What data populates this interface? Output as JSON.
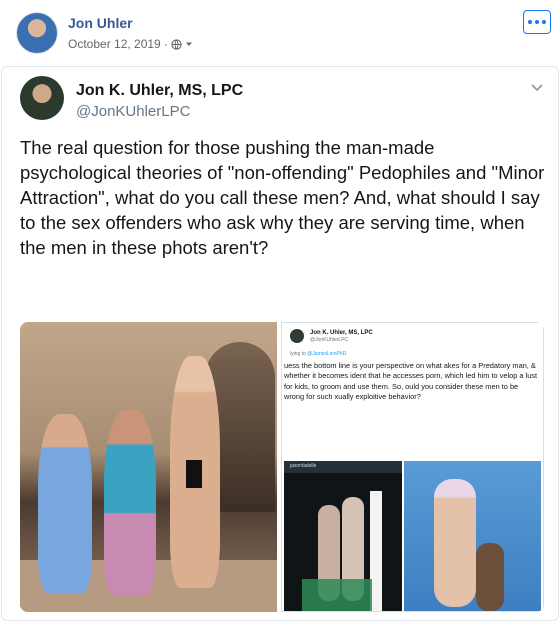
{
  "post": {
    "author": "Jon Uhler",
    "date": "October 12, 2019",
    "separator": "·",
    "privacy_icon": "globe-icon",
    "more_icon": "more-options-icon"
  },
  "tweet": {
    "name": "Jon K. Uhler, MS, LPC",
    "handle": "@JonKUhlerLPC",
    "text": "The real question for those pushing the man-made psychological theories of \"non-offending\" Pedophiles and \"Minor Attraction\", what do you call these men? And, what should I say to the sex offenders who ask why they are serving time, when the men in these phots aren't?",
    "menu_icon": "chevron-down-icon"
  },
  "embedded": {
    "name": "Jon K. Uhler, MS, LPC",
    "handle": "@JonKUhlerLPC",
    "reply_prefix": "lying to",
    "reply_handle": "@JamesLinnPhD",
    "text": "uess the bottom line is your perspective on what akes for a Predatory man, & whether it becomes ident that he accesses porn, which led him to velop a lust for kids, to groom and use them. So, ould you consider these men to be wrong for such xually exploitive behavior?",
    "video_caption": "jasonbalelle"
  },
  "colors": {
    "fb_link": "#385898",
    "fb_blue": "#1877f2",
    "tw_text": "#14171a",
    "tw_muted": "#657786"
  }
}
